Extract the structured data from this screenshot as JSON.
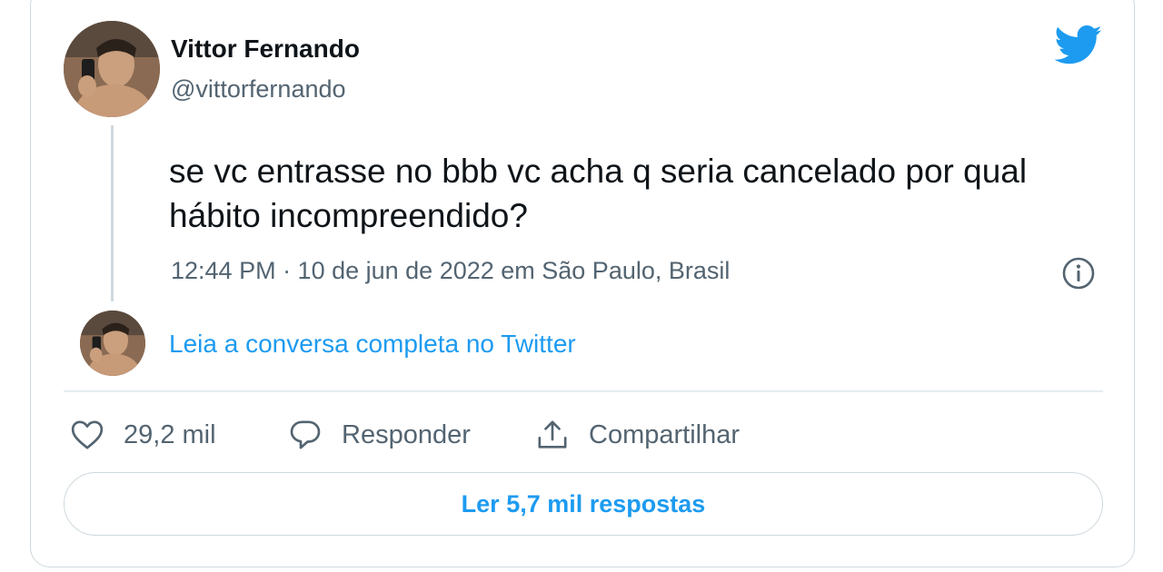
{
  "tweet": {
    "author_name": "Vittor Fernando",
    "author_handle": "@vittorfernando",
    "text": "se vc entrasse no bbb vc acha q seria cancelado por qual hábito incompreendido?",
    "meta": "12:44 PM · 10 de jun de 2022 em São Paulo, Brasil"
  },
  "conversation": {
    "link_label": "Leia a conversa completa no Twitter"
  },
  "actions": {
    "likes_count": "29,2 mil",
    "reply_label": "Responder",
    "share_label": "Compartilhar"
  },
  "replies_button": {
    "label": "Ler 5,7 mil respostas"
  },
  "icons": {
    "brand": "twitter-bird-icon",
    "info": "info-icon",
    "like": "heart-icon",
    "reply": "speech-bubble-icon",
    "share": "share-upload-icon"
  },
  "colors": {
    "brand_blue": "#1d9bf0",
    "text_primary": "#0f1419",
    "text_secondary": "#536471",
    "border": "#cfd9de"
  }
}
